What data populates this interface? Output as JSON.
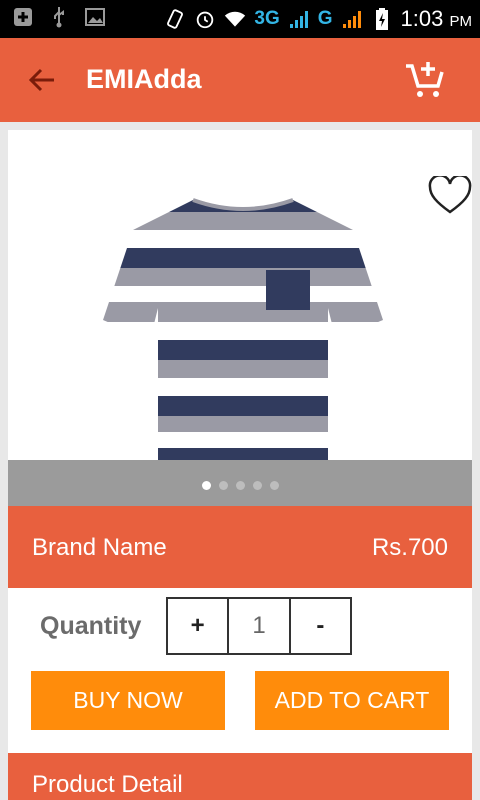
{
  "status_bar": {
    "net_3g": "3G",
    "net_g": "G",
    "time": "1:03",
    "ampm": "PM"
  },
  "app_bar": {
    "title": "EMIAdda",
    "back_icon": "arrow-left-icon",
    "cart_icon": "cart-add-icon"
  },
  "product": {
    "favorite_icon": "heart-outline-icon",
    "image_pager": {
      "count": 5,
      "active_index": 0
    },
    "brand": "Brand Name",
    "price": "Rs.700"
  },
  "quantity": {
    "label": "Quantity",
    "increment": "+",
    "value": "1",
    "decrement": "-"
  },
  "actions": {
    "buy_now": "BUY NOW",
    "add_to_cart": "ADD TO CART"
  },
  "detail": {
    "title": "Product Detail"
  },
  "colors": {
    "primary": "#e8603e",
    "accent": "#ff8c0b"
  }
}
